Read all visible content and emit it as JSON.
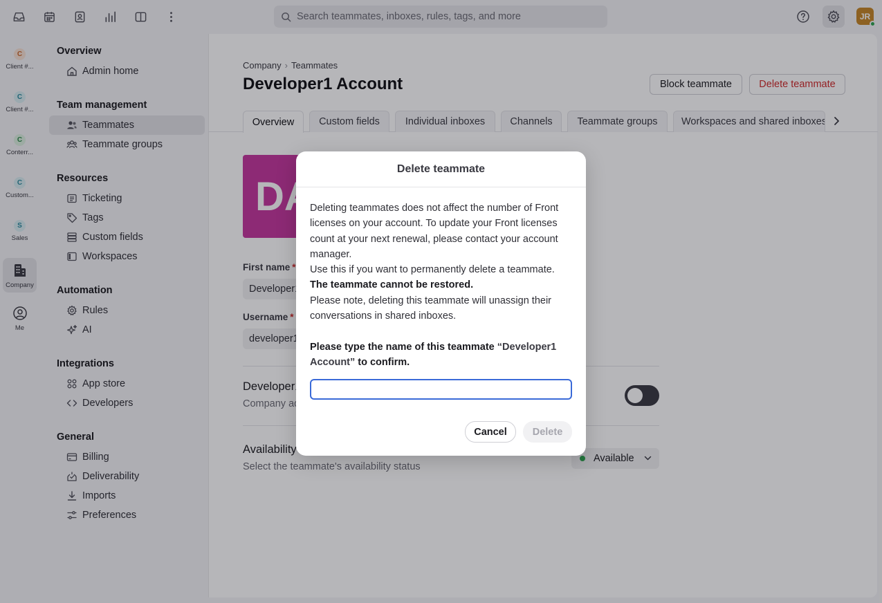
{
  "topbar": {
    "search_placeholder": "Search teammates, inboxes, rules, tags, and more",
    "avatar_initials": "JR"
  },
  "rail": {
    "items": [
      {
        "letter": "C",
        "label": "Client #...",
        "badge_bg": "#f6e1d5",
        "badge_fg": "#c9682c"
      },
      {
        "letter": "C",
        "label": "Client #...",
        "badge_bg": "#d8edf1",
        "badge_fg": "#2d8a9e"
      },
      {
        "letter": "C",
        "label": "Conterr...",
        "badge_bg": "#dcefe0",
        "badge_fg": "#2f8a4a"
      },
      {
        "letter": "C",
        "label": "Custom...",
        "badge_bg": "#d8edf1",
        "badge_fg": "#2d8a9e"
      },
      {
        "letter": "S",
        "label": "Sales",
        "badge_bg": "#d8edf1",
        "badge_fg": "#2d8a9e"
      }
    ],
    "company_label": "Company",
    "me_label": "Me"
  },
  "nav": {
    "overview_heading": "Overview",
    "admin_home": "Admin home",
    "team_heading": "Team management",
    "teammates": "Teammates",
    "teammate_groups": "Teammate groups",
    "resources_heading": "Resources",
    "ticketing": "Ticketing",
    "tags": "Tags",
    "custom_fields": "Custom fields",
    "workspaces": "Workspaces",
    "automation_heading": "Automation",
    "rules": "Rules",
    "ai": "AI",
    "integrations_heading": "Integrations",
    "app_store": "App store",
    "developers": "Developers",
    "general_heading": "General",
    "billing": "Billing",
    "deliverability": "Deliverability",
    "imports": "Imports",
    "preferences": "Preferences"
  },
  "main": {
    "breadcrumb_company": "Company",
    "breadcrumb_teammates": "Teammates",
    "title": "Developer1 Account",
    "block_label": "Block teammate",
    "delete_label": "Delete teammate",
    "tabs": [
      "Overview",
      "Custom fields",
      "Individual inboxes",
      "Channels",
      "Teammate groups",
      "Workspaces and shared inboxes"
    ],
    "avatar_initials": "DA",
    "first_name_label": "First name",
    "first_name_value": "Developer1",
    "username_label": "Username",
    "username_value": "developer1",
    "required_mark": "*",
    "admin_row_title": "Developer1",
    "admin_row_sub": "Company admin",
    "availability_title": "Availability",
    "availability_sub": "Select the teammate's availability status",
    "availability_value": "Available"
  },
  "modal": {
    "title": "Delete teammate",
    "para1": "Deleting teammates does not affect the number of Front licenses on your account. To update your Front licenses count at your next renewal, please contact your account manager.",
    "para2": "Use this if you want to permanently delete a teammate.",
    "para3": "The teammate cannot be restored.",
    "para4": "Please note, deleting this teammate will unassign their conversations in shared inboxes.",
    "confirm_prefix": "Please type the name of this teammate",
    "confirm_name": "“Developer1 Account”",
    "confirm_suffix": "to confirm.",
    "input_value": "",
    "cancel_label": "Cancel",
    "delete_label": "Delete"
  },
  "colors": {
    "accent": "#3a6ad8",
    "danger": "#cf2a2a",
    "avatar_brand": "#c4379e",
    "status_green": "#2ea44f"
  }
}
